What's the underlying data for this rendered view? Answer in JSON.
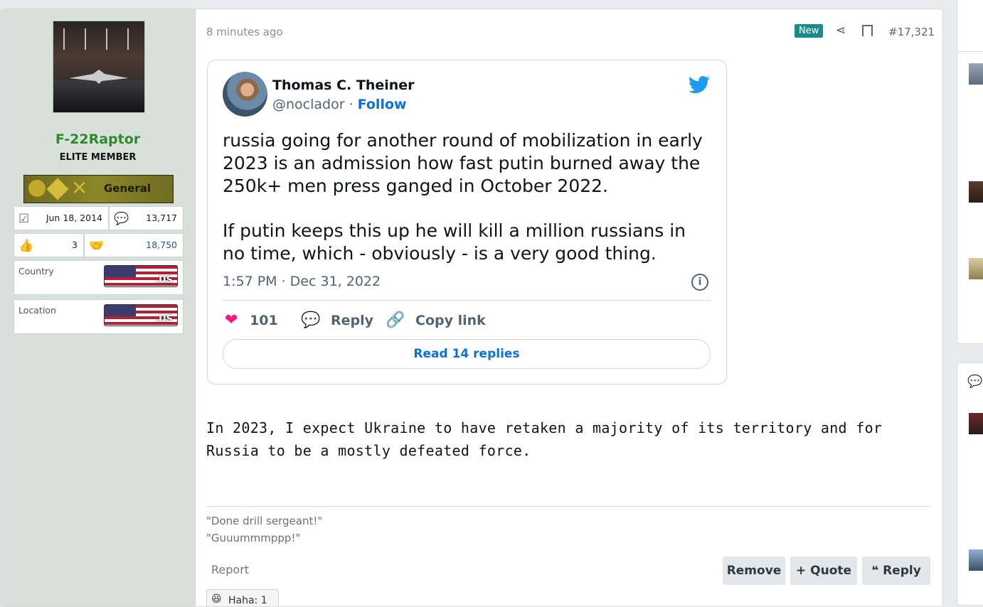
{
  "user": {
    "name": "F-22Raptor",
    "title": "ELITE MEMBER",
    "rank": "General",
    "joined": "Jun 18, 2014",
    "messages": "13,717",
    "reaction_score": "3",
    "points": "18,750",
    "country_label": "Country",
    "location_label": "Location",
    "flag_text": ".US"
  },
  "post": {
    "time": "8 minutes ago",
    "badge": "New",
    "number": "#17,321",
    "body": "In 2023, I expect Ukraine to have retaken a majority of its territory and for Russia to be a mostly defeated force.",
    "signature_line1": "\"Done drill sergeant!\"",
    "signature_line2": "\"Guuummmppp!\"",
    "report": "Report",
    "remove": "Remove",
    "quote": "Quote",
    "reply": "Reply",
    "reaction": "Haha: 1"
  },
  "tweet": {
    "name": "Thomas C. Theiner",
    "handle": "@noclador",
    "dot": "·",
    "follow": "Follow",
    "paragraph1": "russia going for another round of mobilization in early 2023 is an admission how fast putin burned away the 250k+ men press ganged in October 2022.",
    "paragraph2": "If putin keeps this up he will kill a million russians in no time, which - obviously - is a very good thing.",
    "date": "1:57 PM · Dec 31, 2022",
    "likes": "101",
    "reply": "Reply",
    "copy": "Copy link",
    "read_replies": "Read 14 replies"
  },
  "colors": {
    "username": "#2f8a2a",
    "badge": "#1b8a8a",
    "twitter_blue": "#1d9bf0",
    "heart": "#f91880"
  }
}
